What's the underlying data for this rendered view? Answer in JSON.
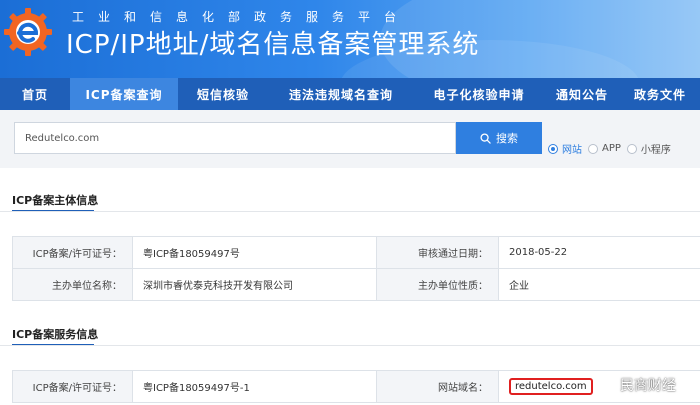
{
  "header": {
    "ministry": "工业和信息化部政务服务平台",
    "title": "ICP/IP地址/域名信息备案管理系统",
    "logo_icon": "gear-e-logo-icon",
    "colors": {
      "header_start": "#1b6ed6",
      "header_end": "#8cc2f5",
      "nav": "#1f5fb8",
      "nav_active": "#3d86e0",
      "accent": "#2f7fe0",
      "highlight": "#e02020",
      "logo": "#f26522"
    }
  },
  "nav": {
    "items": [
      {
        "label": "首页"
      },
      {
        "label": "ICP备案查询",
        "active": true
      },
      {
        "label": "短信核验"
      },
      {
        "label": "违法违规域名查询"
      },
      {
        "label": "电子化核验申请"
      },
      {
        "label": "通知公告"
      },
      {
        "label": "政务文件"
      }
    ]
  },
  "search": {
    "value": "Redutelco.com",
    "button_label": "搜索",
    "button_icon": "search-icon",
    "options": [
      {
        "label": "网站",
        "checked": true
      },
      {
        "label": "APP",
        "checked": false
      },
      {
        "label": "小程序",
        "checked": false
      }
    ]
  },
  "subject_section": {
    "title": "ICP备案主体信息",
    "rows": [
      {
        "label1": "ICP备案/许可证号：",
        "value1": "粤ICP备18059497号",
        "label2": "审核通过日期：",
        "value2": "2018-05-22"
      },
      {
        "label1": "主办单位名称：",
        "value1": "深圳市睿优泰克科技开发有限公司",
        "label2": "主办单位性质：",
        "value2": "企业"
      }
    ]
  },
  "service_section": {
    "title": "ICP备案服务信息",
    "rows": [
      {
        "label1": "ICP备案/许可证号：",
        "value1": "粤ICP备18059497号-1",
        "label2": "网站域名：",
        "value2": "redutelco.com"
      }
    ]
  },
  "watermark": {
    "text": "民商财经",
    "icon": "weibo-icon"
  }
}
